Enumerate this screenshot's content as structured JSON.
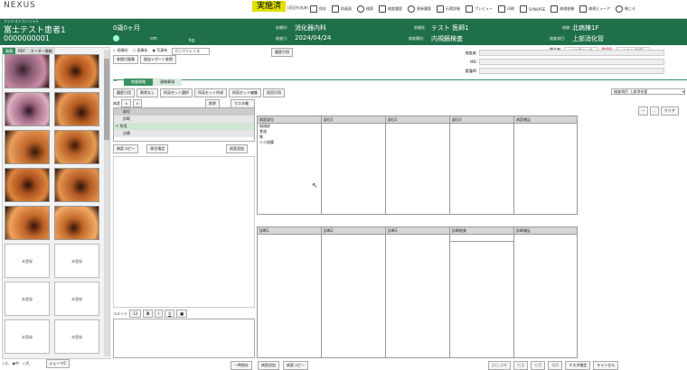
{
  "app": {
    "logo": "NEXUS"
  },
  "status": {
    "badge": "実施済",
    "sub": "(初回作成済)"
  },
  "toolbar": [
    {
      "label": "保存",
      "icon": "save-icon"
    },
    {
      "label": "前画面",
      "icon": "back-icon"
    },
    {
      "label": "検索",
      "icon": "search-icon"
    },
    {
      "label": "検査履歴",
      "icon": "history-icon"
    },
    {
      "label": "更新履歴",
      "icon": "update-history-icon"
    },
    {
      "label": "伝票詳細",
      "icon": "slip-icon"
    },
    {
      "label": "プレビュー",
      "icon": "preview-icon"
    },
    {
      "label": "印刷",
      "icon": "print-icon"
    },
    {
      "label": "SYNAPSE",
      "icon": "synapse-icon"
    },
    {
      "label": "病理依頼",
      "icon": "pathology-request-icon"
    },
    {
      "label": "病理ビューア",
      "icon": "pathology-viewer-icon"
    },
    {
      "label": "閉じる",
      "icon": "close-icon"
    }
  ],
  "patient": {
    "kana": "フジテストカンジャ1",
    "name": "富士テスト患者1",
    "id": "0000000001",
    "age": "0歳0ヶ月",
    "height_unit": "cm",
    "weight_unit": "kg",
    "dept_label": "依頼科:",
    "dept": "消化器内科",
    "date_label": "検査日:",
    "date": "2024/04/24",
    "doctor_label": "依頼医:",
    "doctor": "テスト 医師1",
    "exam_type_label": "検査種別:",
    "exam_type": "内視鏡検査",
    "ward_label": "病棟:",
    "ward": "北病棟1F",
    "exam_item_label": "検査項目:",
    "exam_item": "上部消化管"
  },
  "left": {
    "tabs": [
      "画像",
      "PDF",
      "オーダー情報"
    ],
    "empty_label": "未登録",
    "size_options": [
      "小",
      "中",
      "大"
    ],
    "schema_button": "シェーマC"
  },
  "mid": {
    "options": [
      "画像化",
      "画像化",
      "写真有",
      "カンファレンス"
    ],
    "ref_buttons": [
      "参照付画像",
      "過去レポート参照"
    ],
    "tabs": [
      "検査情報",
      "連絡事項"
    ],
    "action_buttons": [
      "履歴引用",
      "異常なし",
      "所見セット選択",
      "所見セット作成",
      "所見セット編集",
      "前回引用"
    ],
    "list_title": "病変",
    "delete_btn": "削除",
    "master_btn": "マスタ確定",
    "tree": [
      "部位",
      "診断",
      "所見",
      "治療"
    ],
    "copy_btn": "病変コピー",
    "site_btn": "部位指定",
    "add_btn": "病変追加",
    "comment_label": "コメント",
    "font_size": "13"
  },
  "right": {
    "reporter_label": "報告者:",
    "reporter": "デモ用ユーザ",
    "approver_label": "承認医:",
    "approver": "テスト 医師1",
    "fields": [
      "検査者:",
      "MD:",
      "看護師:"
    ],
    "exam_item_select": "検査項目 上部消化管",
    "clear_btn": "クリア",
    "table1_headers": [
      "病変部位",
      "部位1",
      "部位2",
      "部位3",
      "病変補足"
    ],
    "site_list": [
      "咽頭部",
      "食道",
      "胃",
      "十二指腸"
    ],
    "table2_headers": [
      "診断1",
      "診断2",
      "診断3",
      "診断結果",
      "診断補足"
    ]
  },
  "footer": {
    "buttons": [
      "一時保存",
      "病変追加",
      "病変コピー"
    ],
    "right_buttons": [
      "部位 診断",
      "所見",
      "処置",
      "検索",
      "マスタ確定",
      "キャンセル"
    ]
  }
}
